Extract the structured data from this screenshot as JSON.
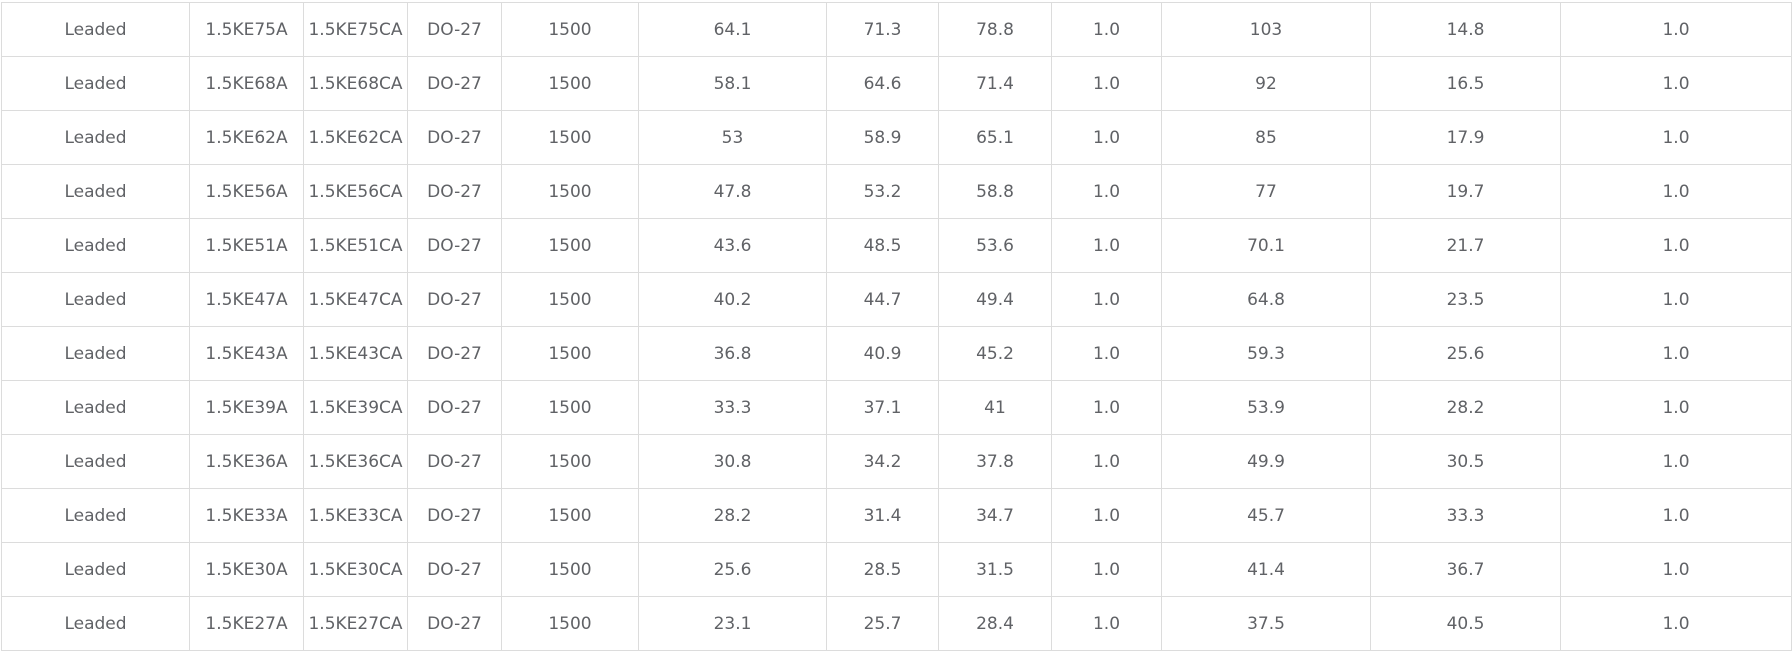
{
  "table": {
    "rows": [
      [
        "Leaded",
        "1.5KE75A",
        "1.5KE75CA",
        "DO-27",
        "1500",
        "64.1",
        "71.3",
        "78.8",
        "1.0",
        "103",
        "14.8",
        "1.0"
      ],
      [
        "Leaded",
        "1.5KE68A",
        "1.5KE68CA",
        "DO-27",
        "1500",
        "58.1",
        "64.6",
        "71.4",
        "1.0",
        "92",
        "16.5",
        "1.0"
      ],
      [
        "Leaded",
        "1.5KE62A",
        "1.5KE62CA",
        "DO-27",
        "1500",
        "53",
        "58.9",
        "65.1",
        "1.0",
        "85",
        "17.9",
        "1.0"
      ],
      [
        "Leaded",
        "1.5KE56A",
        "1.5KE56CA",
        "DO-27",
        "1500",
        "47.8",
        "53.2",
        "58.8",
        "1.0",
        "77",
        "19.7",
        "1.0"
      ],
      [
        "Leaded",
        "1.5KE51A",
        "1.5KE51CA",
        "DO-27",
        "1500",
        "43.6",
        "48.5",
        "53.6",
        "1.0",
        "70.1",
        "21.7",
        "1.0"
      ],
      [
        "Leaded",
        "1.5KE47A",
        "1.5KE47CA",
        "DO-27",
        "1500",
        "40.2",
        "44.7",
        "49.4",
        "1.0",
        "64.8",
        "23.5",
        "1.0"
      ],
      [
        "Leaded",
        "1.5KE43A",
        "1.5KE43CA",
        "DO-27",
        "1500",
        "36.8",
        "40.9",
        "45.2",
        "1.0",
        "59.3",
        "25.6",
        "1.0"
      ],
      [
        "Leaded",
        "1.5KE39A",
        "1.5KE39CA",
        "DO-27",
        "1500",
        "33.3",
        "37.1",
        "41",
        "1.0",
        "53.9",
        "28.2",
        "1.0"
      ],
      [
        "Leaded",
        "1.5KE36A",
        "1.5KE36CA",
        "DO-27",
        "1500",
        "30.8",
        "34.2",
        "37.8",
        "1.0",
        "49.9",
        "30.5",
        "1.0"
      ],
      [
        "Leaded",
        "1.5KE33A",
        "1.5KE33CA",
        "DO-27",
        "1500",
        "28.2",
        "31.4",
        "34.7",
        "1.0",
        "45.7",
        "33.3",
        "1.0"
      ],
      [
        "Leaded",
        "1.5KE30A",
        "1.5KE30CA",
        "DO-27",
        "1500",
        "25.6",
        "28.5",
        "31.5",
        "1.0",
        "41.4",
        "36.7",
        "1.0"
      ],
      [
        "Leaded",
        "1.5KE27A",
        "1.5KE27CA",
        "DO-27",
        "1500",
        "23.1",
        "25.7",
        "28.4",
        "1.0",
        "37.5",
        "40.5",
        "1.0"
      ]
    ]
  }
}
